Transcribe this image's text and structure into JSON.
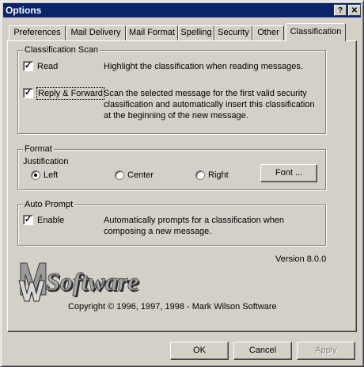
{
  "window": {
    "title": "Options",
    "help_glyph": "?",
    "close_glyph": "✕"
  },
  "tabs": [
    {
      "label": "Preferences"
    },
    {
      "label": "Mail Delivery"
    },
    {
      "label": "Mail Format"
    },
    {
      "label": "Spelling"
    },
    {
      "label": "Security"
    },
    {
      "label": "Other"
    },
    {
      "label": "Classification",
      "active": true
    }
  ],
  "classification_scan": {
    "title": "Classification Scan",
    "read": {
      "label": "Read",
      "checked": true,
      "description": "Highlight the classification when reading messages."
    },
    "reply_forward": {
      "label": "Reply & Forward",
      "checked": true,
      "description": "Scan the selected message for the first valid security classification and automatically insert this classification at the beginning of the new message."
    }
  },
  "format": {
    "title": "Format",
    "justification_label": "Justification",
    "options": [
      {
        "label": "Left",
        "selected": true
      },
      {
        "label": "Center",
        "selected": false
      },
      {
        "label": "Right",
        "selected": false
      }
    ],
    "font_button": "Font ..."
  },
  "auto_prompt": {
    "title": "Auto Prompt",
    "enable": {
      "label": "Enable",
      "checked": true,
      "description": "Automatically prompts for a classification when composing a new message."
    }
  },
  "footer": {
    "logo_text": "Software",
    "version": "Version 8.0.0",
    "copyright": "Copyright © 1996, 1997, 1998  -  Mark Wilson Software"
  },
  "buttons": {
    "ok": "OK",
    "cancel": "Cancel",
    "apply": "Apply"
  },
  "colors": {
    "titlebar": "#0a246a",
    "face": "#d4d0c8"
  },
  "icons": {
    "help": "question-mark-icon",
    "close": "close-icon",
    "check": "check-icon"
  }
}
